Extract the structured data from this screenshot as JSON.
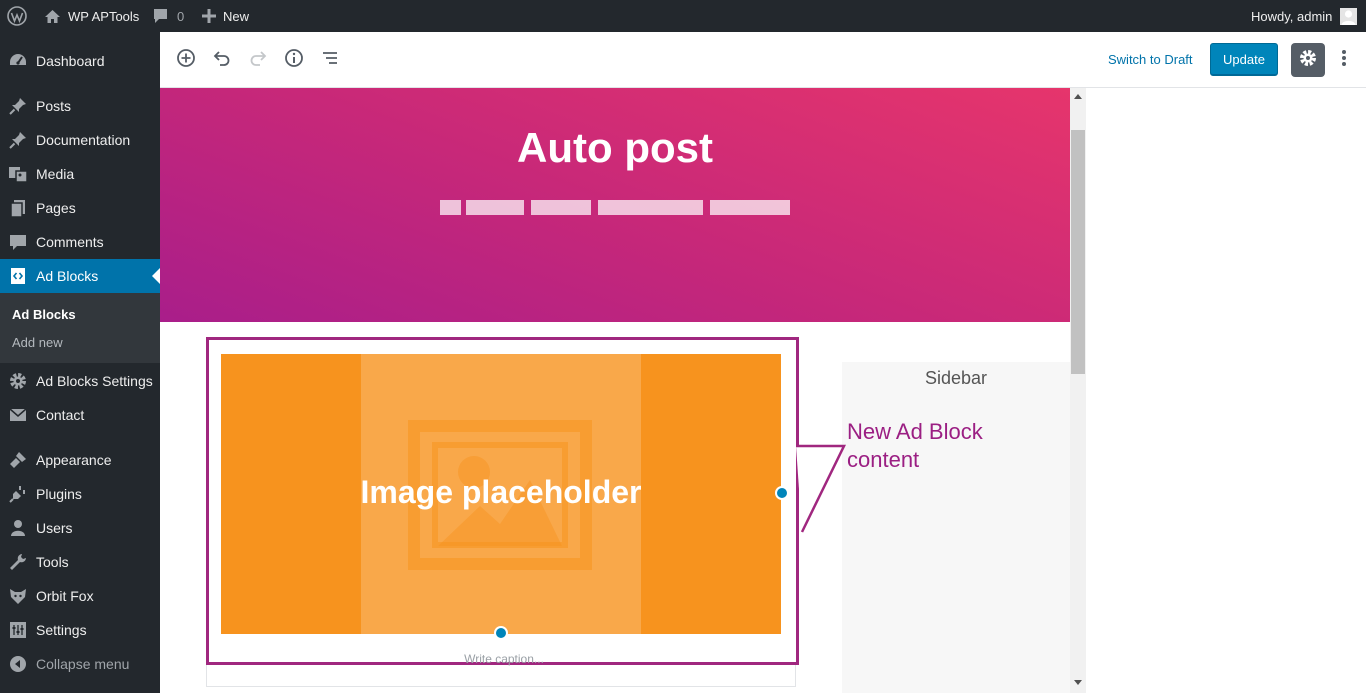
{
  "adminbar": {
    "site_name": "WP APTools",
    "comments_count": "0",
    "new_label": "New",
    "howdy": "Howdy, admin"
  },
  "sidebar": {
    "items": [
      {
        "label": "Dashboard",
        "icon": "dashboard-icon"
      },
      {
        "label": "Posts",
        "icon": "pin-icon"
      },
      {
        "label": "Documentation",
        "icon": "pin-icon"
      },
      {
        "label": "Media",
        "icon": "media-icon"
      },
      {
        "label": "Pages",
        "icon": "pages-icon"
      },
      {
        "label": "Comments",
        "icon": "comment-icon"
      },
      {
        "label": "Ad Blocks",
        "icon": "code-icon",
        "active": true
      },
      {
        "label": "Ad Blocks Settings",
        "icon": "gear-icon"
      },
      {
        "label": "Contact",
        "icon": "envelope-icon"
      },
      {
        "label": "Appearance",
        "icon": "brush-icon"
      },
      {
        "label": "Plugins",
        "icon": "plug-icon"
      },
      {
        "label": "Users",
        "icon": "user-icon"
      },
      {
        "label": "Tools",
        "icon": "wrench-icon"
      },
      {
        "label": "Orbit Fox",
        "icon": "fox-icon"
      },
      {
        "label": "Settings",
        "icon": "settings-sliders-icon"
      },
      {
        "label": "Collapse menu",
        "icon": "collapse-icon"
      }
    ],
    "submenu": [
      {
        "label": "Ad Blocks",
        "current": true
      },
      {
        "label": "Add new",
        "current": false
      }
    ]
  },
  "toolbar": {
    "switch_to_draft": "Switch to Draft",
    "update_label": "Update"
  },
  "content": {
    "post_title": "Auto post",
    "image_placeholder_text": "Image placeholder",
    "caption_placeholder": "Write caption...",
    "sidebar_title": "Sidebar",
    "callout_line1": "New Ad Block",
    "callout_line2": "content"
  },
  "colors": {
    "admin_dark": "#23282d",
    "accent_blue": "#0073aa",
    "hero_start": "#a91e8a",
    "hero_end": "#e6356c",
    "placeholder_orange": "#f7931e",
    "callout_purple": "#9b1f83"
  }
}
